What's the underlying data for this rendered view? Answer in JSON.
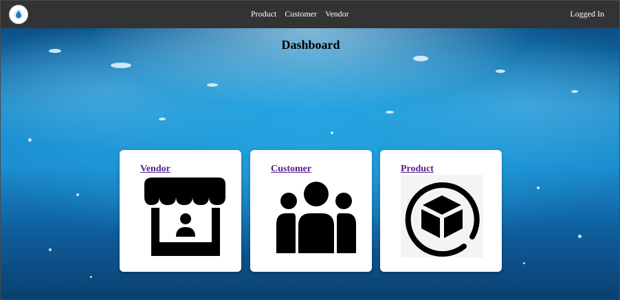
{
  "navbar": {
    "links": [
      "Product",
      "Customer",
      "Vendor"
    ],
    "status": "Logged In",
    "logo_icon": "water-drop-icon"
  },
  "page": {
    "title": "Dashboard"
  },
  "cards": [
    {
      "label": "Vendor",
      "icon": "storefront-icon"
    },
    {
      "label": "Customer",
      "icon": "group-icon"
    },
    {
      "label": "Product",
      "icon": "package-icon"
    }
  ],
  "colors": {
    "navbar_bg": "#333333",
    "link_color": "#551a8b",
    "card_bg": "#ffffff"
  }
}
